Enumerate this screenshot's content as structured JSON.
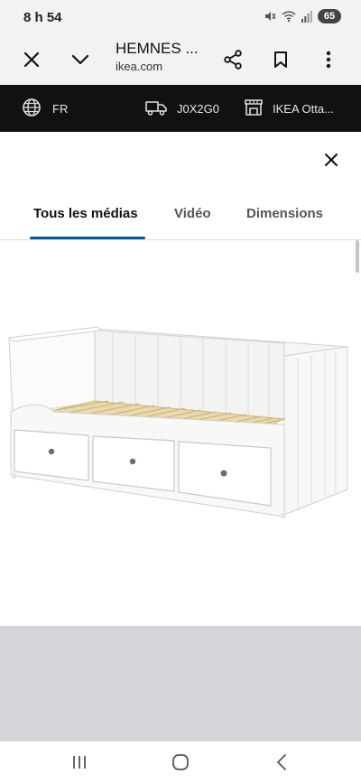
{
  "status": {
    "time": "8 h 54",
    "battery": "65"
  },
  "browser": {
    "title": "HEMNES ...",
    "url": "ikea.com",
    "icons": [
      "close-icon",
      "chevron-down-icon",
      "share-icon",
      "bookmark-icon",
      "more-vert-icon"
    ]
  },
  "ikea_bar": {
    "language": "FR",
    "postal_code": "J0X2G0",
    "store": "IKEA Otta..."
  },
  "media_sheet": {
    "tabs": [
      {
        "label": "Tous les médias",
        "active": true
      },
      {
        "label": "Vidéo",
        "active": false
      },
      {
        "label": "Dimensions",
        "active": false
      }
    ]
  },
  "colors": {
    "accent": "#0058a3",
    "ikea_bar_bg": "#111111",
    "browser_bg": "#f2f2f2",
    "grey_panel": "#d3d5d8"
  }
}
